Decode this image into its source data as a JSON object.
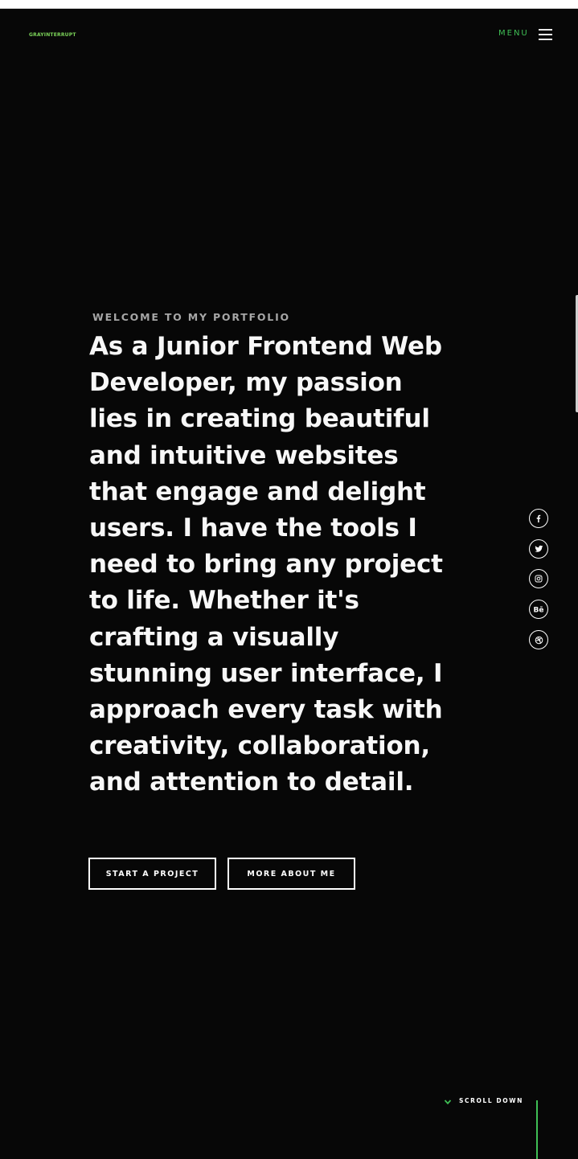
{
  "brand": {
    "logo_text": "GRAYINTERRUPT",
    "accent_color": "#3fbf55"
  },
  "header": {
    "menu_label": "MENU",
    "menu_icon": "hamburger-icon"
  },
  "hero": {
    "eyebrow": "WELCOME TO MY PORTFOLIO",
    "headline": "As a Junior Frontend Web Developer, my passion lies in creating beautiful and intuitive websites that engage and delight users. I have the tools I need to bring any project to life. Whether it's crafting a visually stunning user interface, I approach every task with creativity, collaboration, and attention to detail.",
    "buttons": {
      "start": "START A PROJECT",
      "more": "MORE ABOUT ME"
    }
  },
  "social": [
    {
      "name": "facebook",
      "icon": "facebook-icon"
    },
    {
      "name": "twitter",
      "icon": "twitter-icon"
    },
    {
      "name": "instagram",
      "icon": "instagram-icon"
    },
    {
      "name": "behance",
      "icon": "behance-icon"
    },
    {
      "name": "dribbble",
      "icon": "dribbble-icon"
    }
  ],
  "scroll": {
    "label": "SCROLL DOWN",
    "icon": "chevron-down-icon"
  }
}
